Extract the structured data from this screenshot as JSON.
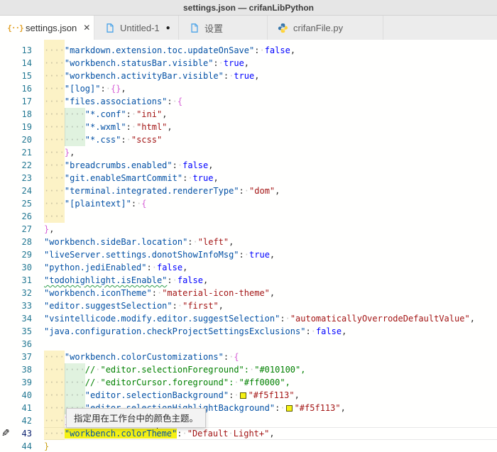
{
  "title_bar": {
    "title": "settings.json — crifanLibPython"
  },
  "tabs": [
    {
      "label": "settings.json",
      "icon": "json-braces-icon",
      "active": true,
      "close_glyph": "✕"
    },
    {
      "label": "Untitled-1",
      "icon": "file-icon",
      "dirty_glyph": "●"
    },
    {
      "label": "设置",
      "icon": "file-icon"
    },
    {
      "label": "crifanFile.py",
      "icon": "python-icon"
    }
  ],
  "tooltip": {
    "text": "指定用在工作台中的颜色主题。"
  },
  "colors": {
    "key": "#0451a5",
    "string": "#a31515",
    "boolean": "#0000ff",
    "comment": "#008000",
    "bracket_root": "#c9a21a",
    "bracket_level2": "#d661d6",
    "selection_background": "#f5f113",
    "line_number": "#237893",
    "indent_band_yellow": "rgba(247,222,109,0.38)",
    "indent_band_green": "rgba(151,211,151,0.30)"
  },
  "editor": {
    "pencil_glyph": "✎",
    "json_icon_glyph": "{··}",
    "lines": [
      {
        "n": "",
        "stub": true,
        "bands": 1,
        "t": []
      },
      {
        "n": 13,
        "bands": 1,
        "t": [
          [
            "ws",
            "····"
          ],
          [
            "key",
            "\"markdown.extension.toc.updateOnSave\""
          ],
          [
            "pun",
            ":"
          ],
          [
            "ws",
            "·"
          ],
          [
            "bool",
            "false"
          ],
          [
            "pun",
            ","
          ]
        ]
      },
      {
        "n": 14,
        "bands": 1,
        "t": [
          [
            "ws",
            "····"
          ],
          [
            "key",
            "\"workbench.statusBar.visible\""
          ],
          [
            "pun",
            ":"
          ],
          [
            "ws",
            "·"
          ],
          [
            "bool",
            "true"
          ],
          [
            "pun",
            ","
          ]
        ]
      },
      {
        "n": 15,
        "bands": 1,
        "t": [
          [
            "ws",
            "····"
          ],
          [
            "key",
            "\"workbench.activityBar.visible\""
          ],
          [
            "pun",
            ":"
          ],
          [
            "ws",
            "·"
          ],
          [
            "bool",
            "true"
          ],
          [
            "pun",
            ","
          ]
        ]
      },
      {
        "n": 16,
        "bands": 1,
        "t": [
          [
            "ws",
            "····"
          ],
          [
            "key",
            "\"[log]\""
          ],
          [
            "pun",
            ":"
          ],
          [
            "ws",
            "·"
          ],
          [
            "b2",
            "{}"
          ],
          [
            "pun",
            ","
          ]
        ]
      },
      {
        "n": 17,
        "bands": 1,
        "t": [
          [
            "ws",
            "····"
          ],
          [
            "key",
            "\"files.associations\""
          ],
          [
            "pun",
            ":"
          ],
          [
            "ws",
            "·"
          ],
          [
            "b2",
            "{"
          ]
        ]
      },
      {
        "n": 18,
        "bands": 2,
        "t": [
          [
            "ws",
            "········"
          ],
          [
            "key",
            "\"*.conf\""
          ],
          [
            "pun",
            ":"
          ],
          [
            "ws",
            "·"
          ],
          [
            "str",
            "\"ini\""
          ],
          [
            "pun",
            ","
          ]
        ]
      },
      {
        "n": 19,
        "bands": 2,
        "t": [
          [
            "ws",
            "········"
          ],
          [
            "key",
            "\"*.wxml\""
          ],
          [
            "pun",
            ":"
          ],
          [
            "ws",
            "·"
          ],
          [
            "str",
            "\"html\""
          ],
          [
            "pun",
            ","
          ]
        ]
      },
      {
        "n": 20,
        "bands": 2,
        "t": [
          [
            "ws",
            "········"
          ],
          [
            "key",
            "\"*.css\""
          ],
          [
            "pun",
            ":"
          ],
          [
            "ws",
            "·"
          ],
          [
            "str",
            "\"scss\""
          ]
        ]
      },
      {
        "n": 21,
        "bands": 1,
        "t": [
          [
            "ws",
            "····"
          ],
          [
            "b2",
            "}"
          ],
          [
            "pun",
            ","
          ]
        ]
      },
      {
        "n": 22,
        "bands": 1,
        "t": [
          [
            "ws",
            "····"
          ],
          [
            "key",
            "\"breadcrumbs.enabled\""
          ],
          [
            "pun",
            ":"
          ],
          [
            "ws",
            "·"
          ],
          [
            "bool",
            "false"
          ],
          [
            "pun",
            ","
          ]
        ]
      },
      {
        "n": 23,
        "bands": 1,
        "t": [
          [
            "ws",
            "····"
          ],
          [
            "key",
            "\"git.enableSmartCommit\""
          ],
          [
            "pun",
            ":"
          ],
          [
            "ws",
            "·"
          ],
          [
            "bool",
            "true"
          ],
          [
            "pun",
            ","
          ]
        ]
      },
      {
        "n": 24,
        "bands": 1,
        "t": [
          [
            "ws",
            "····"
          ],
          [
            "key",
            "\"terminal.integrated.rendererType\""
          ],
          [
            "pun",
            ":"
          ],
          [
            "ws",
            "·"
          ],
          [
            "str",
            "\"dom\""
          ],
          [
            "pun",
            ","
          ]
        ]
      },
      {
        "n": 25,
        "bands": 1,
        "t": [
          [
            "ws",
            "····"
          ],
          [
            "key",
            "\"[plaintext]\""
          ],
          [
            "pun",
            ":"
          ],
          [
            "ws",
            "·"
          ],
          [
            "b2",
            "{"
          ]
        ]
      },
      {
        "n": 26,
        "bands": 1,
        "t": [
          [
            "ws",
            "····"
          ]
        ]
      },
      {
        "n": 27,
        "bands": 0,
        "t": [
          [
            "b2",
            "}"
          ],
          [
            "pun",
            ","
          ]
        ]
      },
      {
        "n": 28,
        "bands": 0,
        "t": [
          [
            "key",
            "\"workbench.sideBar.location\""
          ],
          [
            "pun",
            ":"
          ],
          [
            "ws",
            "·"
          ],
          [
            "str",
            "\"left\""
          ],
          [
            "pun",
            ","
          ]
        ]
      },
      {
        "n": 29,
        "bands": 0,
        "t": [
          [
            "key",
            "\"liveServer.settings.donotShowInfoMsg\""
          ],
          [
            "pun",
            ":"
          ],
          [
            "ws",
            "·"
          ],
          [
            "bool",
            "true"
          ],
          [
            "pun",
            ","
          ]
        ]
      },
      {
        "n": 30,
        "bands": 0,
        "t": [
          [
            "key",
            "\"python.jediEnabled\""
          ],
          [
            "pun",
            ":"
          ],
          [
            "ws",
            "·"
          ],
          [
            "bool",
            "false"
          ],
          [
            "pun",
            ","
          ]
        ]
      },
      {
        "n": 31,
        "bands": 0,
        "t": [
          [
            "keywarn",
            "\"todohighlight.isEnable\""
          ],
          [
            "pun",
            ":"
          ],
          [
            "ws",
            "·"
          ],
          [
            "bool",
            "false"
          ],
          [
            "pun",
            ","
          ]
        ]
      },
      {
        "n": 32,
        "bands": 0,
        "t": [
          [
            "key",
            "\"workbench.iconTheme\""
          ],
          [
            "pun",
            ":"
          ],
          [
            "ws",
            "·"
          ],
          [
            "str",
            "\"material-icon-theme\""
          ],
          [
            "pun",
            ","
          ]
        ]
      },
      {
        "n": 33,
        "bands": 0,
        "t": [
          [
            "key",
            "\"editor.suggestSelection\""
          ],
          [
            "pun",
            ":"
          ],
          [
            "ws",
            "·"
          ],
          [
            "str",
            "\"first\""
          ],
          [
            "pun",
            ","
          ]
        ]
      },
      {
        "n": 34,
        "bands": 0,
        "t": [
          [
            "key",
            "\"vsintellicode.modify.editor.suggestSelection\""
          ],
          [
            "pun",
            ":"
          ],
          [
            "ws",
            "·"
          ],
          [
            "str",
            "\"automaticallyOverrodeDefaultValue\""
          ],
          [
            "pun",
            ","
          ]
        ]
      },
      {
        "n": 35,
        "bands": 0,
        "t": [
          [
            "key",
            "\"java.configuration.checkProjectSettingsExclusions\""
          ],
          [
            "pun",
            ":"
          ],
          [
            "ws",
            "·"
          ],
          [
            "bool",
            "false"
          ],
          [
            "pun",
            ","
          ]
        ]
      },
      {
        "n": 36,
        "bands": 0,
        "t": []
      },
      {
        "n": 37,
        "bands": 1,
        "t": [
          [
            "ws",
            "····"
          ],
          [
            "key",
            "\"workbench.colorCustomizations\""
          ],
          [
            "pun",
            ":"
          ],
          [
            "ws",
            "·"
          ],
          [
            "b2",
            "{"
          ]
        ]
      },
      {
        "n": 38,
        "bands": 2,
        "t": [
          [
            "ws",
            "········"
          ],
          [
            "com",
            "//"
          ],
          [
            "ws",
            "·"
          ],
          [
            "com",
            "\"editor.selectionForeground\":"
          ],
          [
            "ws",
            "·"
          ],
          [
            "com",
            "\"#010100\","
          ]
        ]
      },
      {
        "n": 39,
        "bands": 2,
        "t": [
          [
            "ws",
            "········"
          ],
          [
            "com",
            "//"
          ],
          [
            "ws",
            "·"
          ],
          [
            "com",
            "\"editorCursor.foreground\":"
          ],
          [
            "ws",
            "·"
          ],
          [
            "com",
            "\"#ff0000\","
          ]
        ]
      },
      {
        "n": 40,
        "bands": 2,
        "t": [
          [
            "ws",
            "········"
          ],
          [
            "key",
            "\"editor.selectionBackground\""
          ],
          [
            "pun",
            ":"
          ],
          [
            "ws",
            "·"
          ],
          [
            "swatch",
            ""
          ],
          [
            "str",
            "\"#f5f113\""
          ],
          [
            "pun",
            ","
          ]
        ]
      },
      {
        "n": 41,
        "bands": 2,
        "t": [
          [
            "ws",
            "········"
          ],
          [
            "key",
            "\"editor.selectionHighlightBackground\""
          ],
          [
            "pun",
            ":"
          ],
          [
            "ws",
            "·"
          ],
          [
            "swatch",
            ""
          ],
          [
            "str",
            "\"#f5f113\""
          ],
          [
            "pun",
            ","
          ]
        ]
      },
      {
        "n": 42,
        "bands": 1,
        "t": [
          [
            "ws",
            "····"
          ],
          [
            "b2",
            "}"
          ],
          [
            "pun",
            ","
          ]
        ]
      },
      {
        "n": 43,
        "bands": 1,
        "active": true,
        "pencil": true,
        "t": [
          [
            "ws",
            "····"
          ],
          [
            "keysel",
            "\"workbench.colorTh"
          ],
          [
            "cursor",
            ""
          ],
          [
            "keysel",
            "eme\""
          ],
          [
            "pun",
            ":"
          ],
          [
            "ws",
            "·"
          ],
          [
            "str",
            "\"Default"
          ],
          [
            "ws",
            "·"
          ],
          [
            "str",
            "Light+\""
          ],
          [
            "pun",
            ","
          ]
        ]
      },
      {
        "n": 44,
        "bands": 0,
        "t": [
          [
            "b1",
            "}"
          ]
        ]
      }
    ]
  }
}
